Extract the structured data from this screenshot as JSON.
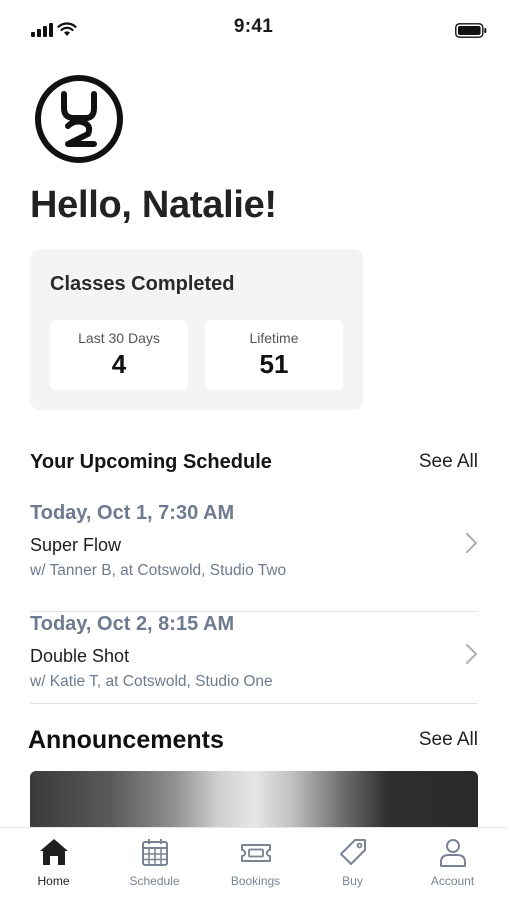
{
  "status_bar": {
    "time": "9:41"
  },
  "greeting": "Hello, Natalie!",
  "stats": {
    "title": "Classes Completed",
    "items": [
      {
        "label": "Last 30 Days",
        "value": "4"
      },
      {
        "label": "Lifetime",
        "value": "51"
      }
    ]
  },
  "schedule": {
    "title": "Your Upcoming Schedule",
    "see_all": "See All",
    "items": [
      {
        "when": "Today, Oct 1, 7:30 AM",
        "class_name": "Super Flow",
        "details": "w/ Tanner B, at Cotswold, Studio Two"
      },
      {
        "when": "Today, Oct 2, 8:15 AM",
        "class_name": "Double Shot",
        "details": "w/ Katie T, at Cotswold, Studio One"
      }
    ]
  },
  "announcements": {
    "title": "Announcements",
    "see_all": "See All"
  },
  "tabs": [
    {
      "label": "Home",
      "icon": "home-icon",
      "active": true
    },
    {
      "label": "Schedule",
      "icon": "calendar-icon",
      "active": false
    },
    {
      "label": "Bookings",
      "icon": "ticket-icon",
      "active": false
    },
    {
      "label": "Buy",
      "icon": "tag-icon",
      "active": false
    },
    {
      "label": "Account",
      "icon": "user-icon",
      "active": false
    }
  ],
  "colors": {
    "accent_muted": "#6e7a8f",
    "card_bg": "#f4f4f4",
    "active_tab": "#1f1f1f",
    "inactive_tab": "#7a8394"
  }
}
